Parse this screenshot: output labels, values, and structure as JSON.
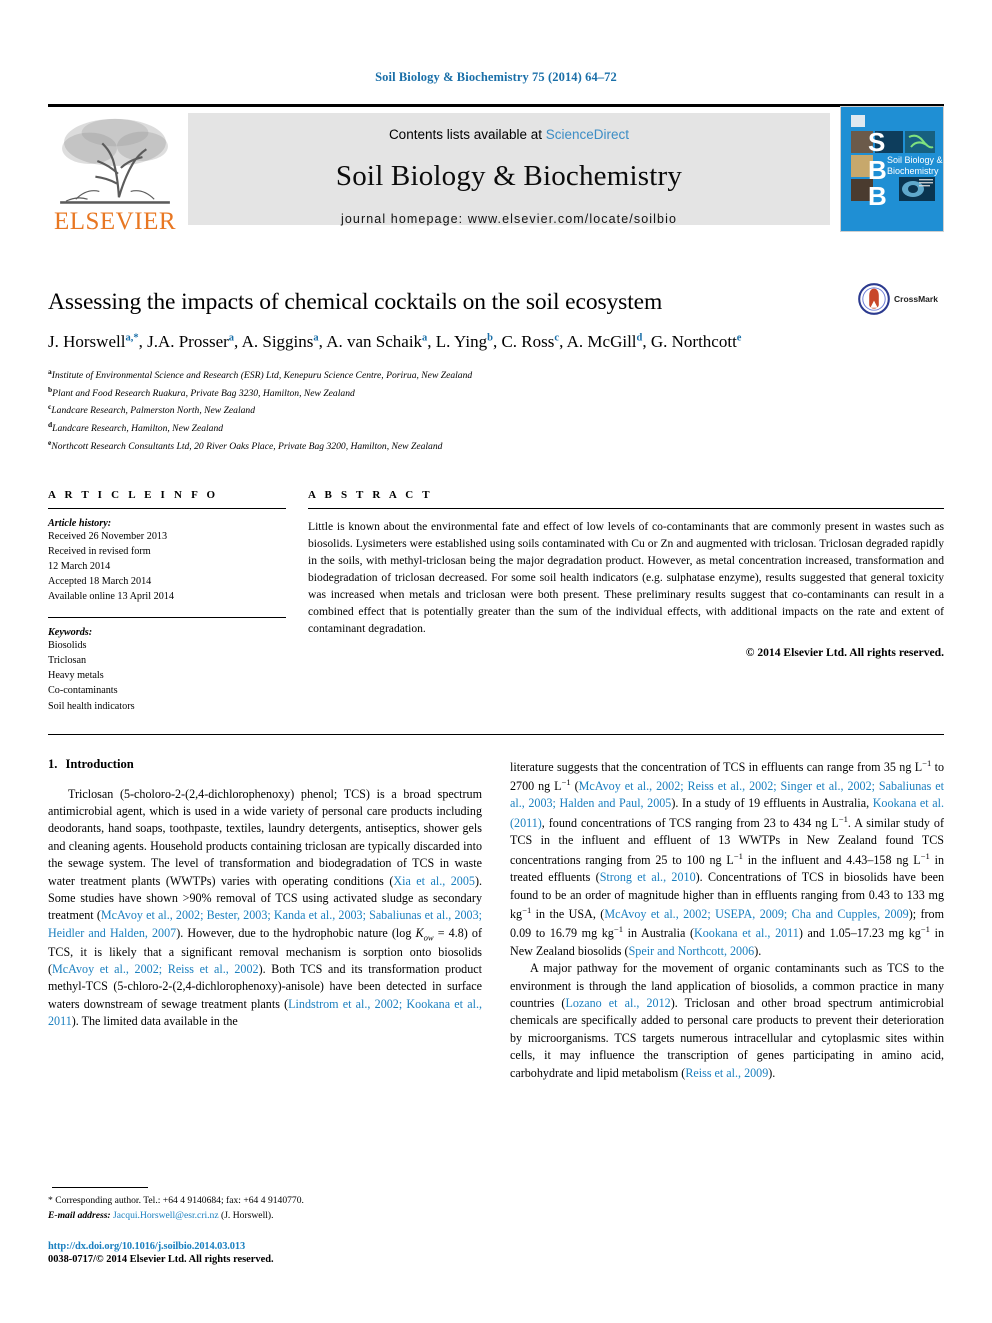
{
  "running_head": "Soil Biology & Biochemistry 75 (2014) 64–72",
  "masthead": {
    "publisher_name": "ELSEVIER",
    "contents_prefix": "Contents lists available at ",
    "sciencedirect": "ScienceDirect",
    "journal_name": "Soil Biology & Biochemistry",
    "homepage": "journal homepage: www.elsevier.com/locate/soilbio",
    "cover_letters": [
      "S",
      "B",
      "B"
    ],
    "cover_title_line1": "Soil Biology &",
    "cover_title_line2": "Biochemistry",
    "accent_orange": "#E87722",
    "accent_blue": "#1A7FBF",
    "band_gray": "#E4E4E4",
    "cover_blue": "#1F8FD4"
  },
  "crossmark": {
    "label": "CrossMark"
  },
  "article": {
    "title": "Assessing the impacts of chemical cocktails on the soil ecosystem",
    "authors": [
      {
        "name": "J. Horswell",
        "marks": "a,*",
        "sep": ", "
      },
      {
        "name": "J.A. Prosser",
        "marks": "a",
        "sep": ", "
      },
      {
        "name": "A. Siggins",
        "marks": "a",
        "sep": ", "
      },
      {
        "name": "A. van Schaik",
        "marks": "a",
        "sep": ", "
      },
      {
        "name": "L. Ying",
        "marks": "b",
        "sep": ", "
      },
      {
        "name": "C. Ross",
        "marks": "c",
        "sep": ", "
      },
      {
        "name": "A. McGill",
        "marks": "d",
        "sep": ", "
      },
      {
        "name": "G. Northcott",
        "marks": "e",
        "sep": ""
      }
    ],
    "affiliations": [
      {
        "mark": "a",
        "text": "Institute of Environmental Science and Research (ESR) Ltd, Kenepuru Science Centre, Porirua, New Zealand"
      },
      {
        "mark": "b",
        "text": "Plant and Food Research Ruakura, Private Bag 3230, Hamilton, New Zealand"
      },
      {
        "mark": "c",
        "text": "Landcare Research, Palmerston North, New Zealand"
      },
      {
        "mark": "d",
        "text": "Landcare Research, Hamilton, New Zealand"
      },
      {
        "mark": "e",
        "text": "Northcott Research Consultants Ltd, 20 River Oaks Place, Private Bag 3200, Hamilton, New Zealand"
      }
    ]
  },
  "article_info": {
    "heading": "A R T I C L E   I N F O",
    "history_label": "Article history:",
    "history": [
      "Received 26 November 2013",
      "Received in revised form",
      "12 March 2014",
      "Accepted 18 March 2014",
      "Available online 13 April 2014"
    ],
    "keywords_label": "Keywords:",
    "keywords": [
      "Biosolids",
      "Triclosan",
      "Heavy metals",
      "Co-contaminants",
      "Soil health indicators"
    ]
  },
  "abstract": {
    "heading": "A B S T R A C T",
    "text": "Little is known about the environmental fate and effect of low levels of co-contaminants that are commonly present in wastes such as biosolids. Lysimeters were established using soils contaminated with Cu or Zn and augmented with triclosan. Triclosan degraded rapidly in the soils, with methyl-triclosan being the major degradation product. However, as metal concentration increased, transformation and biodegradation of triclosan decreased. For some soil health indicators (e.g. sulphatase enzyme), results suggested that general toxicity was increased when metals and triclosan were both present. These preliminary results suggest that co-contaminants can result in a combined effect that is potentially greater than the sum of the individual effects, with additional impacts on the rate and extent of contaminant degradation.",
    "copyright": "© 2014 Elsevier Ltd. All rights reserved."
  },
  "body": {
    "section_number": "1.",
    "section_title": "Introduction",
    "left_paragraph_parts": [
      {
        "t": "Triclosan (5-choloro-2-(2,4-dichlorophenoxy) phenol; TCS) is a broad spectrum antimicrobial agent, which is used in a wide variety of personal care products including deodorants, hand soaps, toothpaste, textiles, laundry detergents, antiseptics, shower gels and cleaning agents. Household products containing triclosan are typically discarded into the sewage system. The level of transformation and biodegradation of TCS in waste water treatment plants (WWTPs) varies with operating conditions ("
      },
      {
        "t": "Xia et al., 2005",
        "ref": true
      },
      {
        "t": "). Some studies have shown >90% removal of TCS using activated sludge as secondary treatment ("
      },
      {
        "t": "McAvoy et al., 2002; Bester, 2003; Kanda et al., 2003; Sabaliunas et al., 2003; Heidler and Halden, 2007",
        "ref": true
      },
      {
        "t": "). However, due to the hydrophobic nature (log "
      },
      {
        "t": "K",
        "ital": true
      },
      {
        "t": "ow",
        "sub": true,
        "ital": true
      },
      {
        "t": " = 4.8) of TCS, it is likely that a significant removal mechanism is sorption onto biosolids ("
      },
      {
        "t": "McAvoy et al., 2002; Reiss et al., 2002",
        "ref": true
      },
      {
        "t": "). Both TCS and its transformation product methyl-TCS (5-chloro-2-(2,4-dichlorophenoxy)-anisole) have been detected in surface waters downstream of sewage treatment plants ("
      },
      {
        "t": "Lindstrom et al., 2002; Kookana et al., 2011",
        "ref": true
      },
      {
        "t": "). The limited data available in the"
      }
    ],
    "right_paragraph1_parts": [
      {
        "t": "literature suggests that the concentration of TCS in effluents can range from 35 ng L"
      },
      {
        "t": "−1",
        "sup": true
      },
      {
        "t": " to 2700 ng L"
      },
      {
        "t": "−1",
        "sup": true
      },
      {
        "t": " ("
      },
      {
        "t": "McAvoy et al., 2002; Reiss et al., 2002; Singer et al., 2002; Sabaliunas et al., 2003; Halden and Paul, 2005",
        "ref": true
      },
      {
        "t": "). In a study of 19 effluents in Australia, "
      },
      {
        "t": "Kookana et al. (2011)",
        "ref": true
      },
      {
        "t": ", found concentrations of TCS ranging from 23 to 434 ng L"
      },
      {
        "t": "−1",
        "sup": true
      },
      {
        "t": ". A similar study of TCS in the influent and effluent of 13 WWTPs in New Zealand found TCS concentrations ranging from 25 to 100 ng L"
      },
      {
        "t": "−1",
        "sup": true
      },
      {
        "t": " in the influent and 4.43–158 ng L"
      },
      {
        "t": "−1",
        "sup": true
      },
      {
        "t": " in treated effluents ("
      },
      {
        "t": "Strong et al., 2010",
        "ref": true
      },
      {
        "t": "). Concentrations of TCS in biosolids have been found to be an order of magnitude higher than in effluents ranging from 0.43 to 133 mg kg"
      },
      {
        "t": "−1",
        "sup": true
      },
      {
        "t": " in the USA, ("
      },
      {
        "t": "McAvoy et al., 2002; USEPA, 2009; Cha and Cupples, 2009",
        "ref": true
      },
      {
        "t": "); from 0.09 to 16.79 mg kg"
      },
      {
        "t": "−1",
        "sup": true
      },
      {
        "t": " in Australia ("
      },
      {
        "t": "Kookana et al., 2011",
        "ref": true
      },
      {
        "t": ") and 1.05–17.23 mg kg"
      },
      {
        "t": "−1",
        "sup": true
      },
      {
        "t": " in New Zealand biosolids ("
      },
      {
        "t": "Speir and Northcott, 2006",
        "ref": true
      },
      {
        "t": ")."
      }
    ],
    "right_paragraph2_parts": [
      {
        "t": "A major pathway for the movement of organic contaminants such as TCS to the environment is through the land application of biosolids, a common practice in many countries ("
      },
      {
        "t": "Lozano et al., 2012",
        "ref": true
      },
      {
        "t": "). Triclosan and other broad spectrum antimicrobial chemicals are specifically added to personal care products to prevent their deterioration by microorganisms. TCS targets numerous intracellular and cytoplasmic sites within cells, it may influence the transcription of genes participating in amino acid, carbohydrate and lipid metabolism ("
      },
      {
        "t": "Reiss et al., 2009",
        "ref": true
      },
      {
        "t": ")."
      }
    ]
  },
  "footnote": {
    "corresponding": "* Corresponding author. Tel.: +64 4 9140684; fax: +64 4 9140770.",
    "email_label": "E-mail address:",
    "email": "Jacqui.Horswell@esr.cri.nz",
    "email_suffix": "(J. Horswell)."
  },
  "page_footer": {
    "doi": "http://dx.doi.org/10.1016/j.soilbio.2014.03.013",
    "issn_copyright": "0038-0717/© 2014 Elsevier Ltd. All rights reserved."
  }
}
